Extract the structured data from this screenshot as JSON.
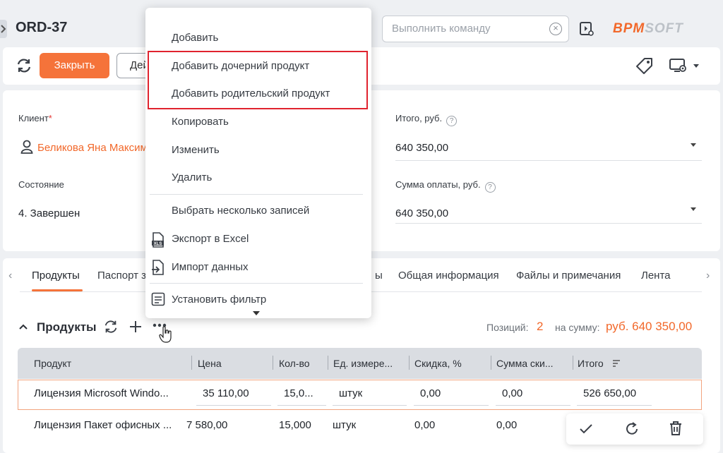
{
  "header": {
    "title": "ORD-37",
    "command_placeholder": "Выполнить команду",
    "logo_part1": "BPM",
    "logo_part2": "SOFT"
  },
  "actions": {
    "close_label": "Закрыть",
    "actions_label": "Дей"
  },
  "fields": {
    "client_label": "Клиент",
    "client_value": "Беликова Яна Максим",
    "state_label": "Состояние",
    "state_value": "4. Завершен",
    "total_label": "Итого, руб.",
    "total_value": "640 350,00",
    "payment_label": "Сумма оплаты, руб.",
    "payment_value": "640 350,00"
  },
  "tabs": [
    {
      "label": "Продукты"
    },
    {
      "label": "Паспорт з"
    },
    {
      "label": "ы"
    },
    {
      "label": "Общая информация"
    },
    {
      "label": "Файлы и примечания"
    },
    {
      "label": "Лента"
    }
  ],
  "detail": {
    "title": "Продукты",
    "positions_label": "Позиций:",
    "positions_value": "2",
    "sum_label": "на сумму:",
    "sum_value": "руб. 640 350,00"
  },
  "grid": {
    "columns": [
      "Продукт",
      "Цена",
      "Кол-во",
      "Ед. измере...",
      "Скидка, %",
      "Сумма ски...",
      "Итого"
    ],
    "rows": [
      [
        "Лицензия Microsoft Windo...",
        "35 110,00",
        "15,0...",
        "штук",
        "0,00",
        "0,00",
        "526 650,00"
      ],
      [
        "Лицензия Пакет офисных ...",
        "7 580,00",
        "15,000",
        "штук",
        "0,00",
        "0,00",
        ""
      ]
    ]
  },
  "menu": {
    "items": [
      "Добавить",
      "Добавить дочерний продукт",
      "Добавить родительский продукт",
      "Копировать",
      "Изменить",
      "Удалить",
      "Выбрать несколько записей",
      "Экспорт в Excel",
      "Импорт данных",
      "Установить фильтр"
    ],
    "excel_icon_text": "XLS"
  },
  "colors": {
    "accent": "#f5733a",
    "link": "#f2682a",
    "highlight": "#e0232e"
  }
}
